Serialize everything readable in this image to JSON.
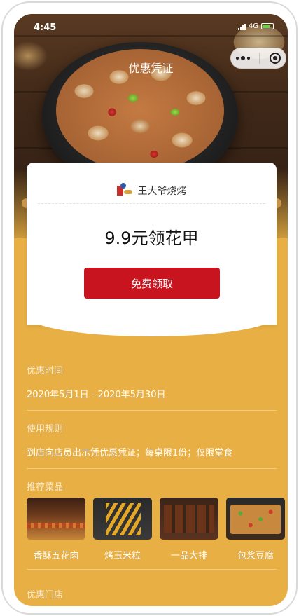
{
  "status_bar": {
    "time": "4:45",
    "network": "4G"
  },
  "nav": {
    "title": "优惠凭证"
  },
  "coupon": {
    "brand_name": "王大爷烧烤",
    "title": "9.9元领花甲",
    "button_label": "免费领取"
  },
  "details": {
    "time_label": "优惠时间",
    "time_value": "2020年5月1日 - 2020年5月30日",
    "rules_label": "使用规则",
    "rules_value": "到店向店员出示凭优惠凭证；每桌限1份；仅限堂食",
    "dishes_label": "推荐菜品",
    "dishes": [
      {
        "name": "香酥五花肉"
      },
      {
        "name": "烤玉米粒"
      },
      {
        "name": "一品大排"
      },
      {
        "name": "包浆豆腐"
      }
    ],
    "stores_label": "优惠门店"
  },
  "colors": {
    "accent_red": "#c8141f",
    "panel_yellow": "#e8b044",
    "card_white": "#ffffff"
  },
  "icons": [
    "signal-icon",
    "battery-icon",
    "more-icon",
    "close-icon",
    "brand-logo"
  ]
}
